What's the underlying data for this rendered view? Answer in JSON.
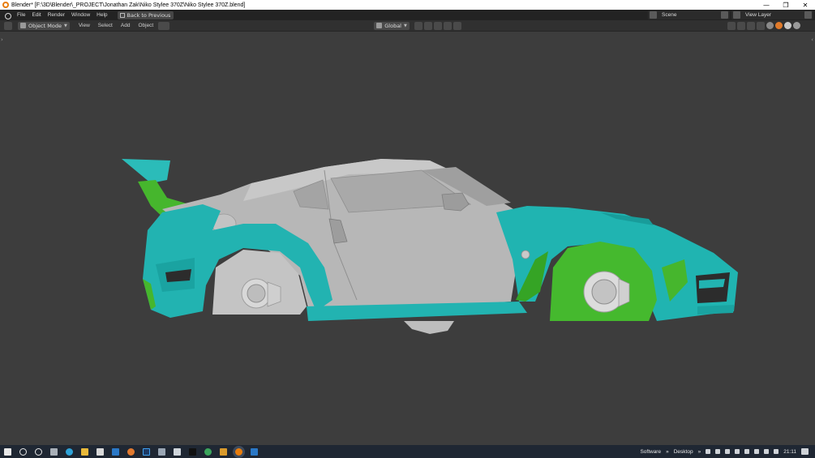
{
  "titlebar": {
    "title": "Blender* [F:\\3D\\Blender\\_PROJECT\\Jonathan Zak\\Niko Stylee 370Z\\Niko Stylee 370Z.blend]",
    "minimize": "—",
    "restore": "❐",
    "close": "✕"
  },
  "topbar": {
    "menu": [
      "File",
      "Edit",
      "Render",
      "Window",
      "Help"
    ],
    "back_label": "Back to Previous",
    "scene_label": "Scene",
    "view_layer_label": "View Layer"
  },
  "header": {
    "mode_label": "Object Mode",
    "menus": [
      "View",
      "Select",
      "Add",
      "Object"
    ],
    "transform_label": "Global"
  },
  "taskbar": {
    "software_label": "Software",
    "desktop_label": "Desktop",
    "clock": "21:11",
    "chevron": "»"
  },
  "colors": {
    "viewport_bg": "#3d3d3d",
    "body_grey": "#b9b9b9",
    "teal": "#1fb4b2",
    "green": "#3db52b"
  },
  "icons": {
    "app": "blender-icon",
    "windows": "windows-start-icon"
  }
}
